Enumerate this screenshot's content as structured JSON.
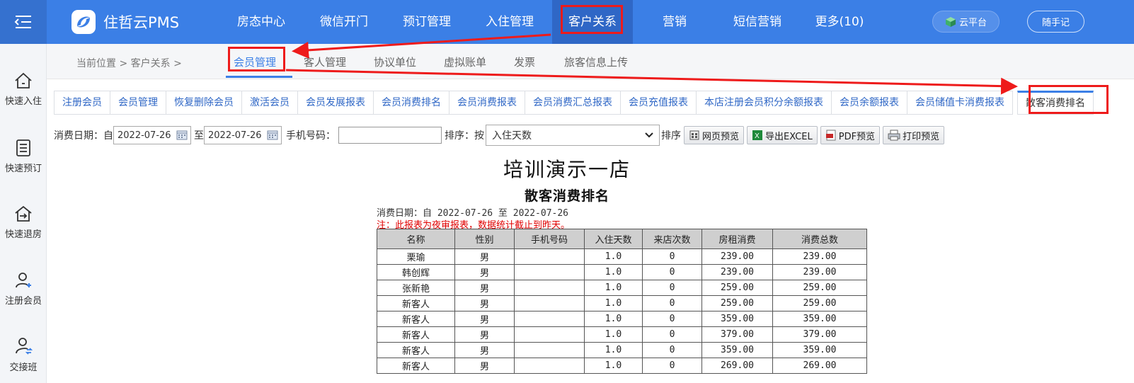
{
  "app": {
    "logo_text": "住哲云PMS"
  },
  "topnav": [
    "房态中心",
    "微信开门",
    "预订管理",
    "入住管理",
    "客户关系",
    "营销",
    "短信营销",
    "更多(10)"
  ],
  "topbar_buttons": {
    "cloud": "云平台",
    "notes": "随手记"
  },
  "sidebar": [
    "快速入住",
    "快速预订",
    "快速退房",
    "注册会员",
    "交接班"
  ],
  "breadcrumb": "当前位置 > 客户关系 >",
  "subtabs": [
    "会员管理",
    "客人管理",
    "协议单位",
    "虚拟账单",
    "发票",
    "旅客信息上传"
  ],
  "tabs": [
    "注册会员",
    "会员管理",
    "恢复删除会员",
    "激活会员",
    "会员发展报表",
    "会员消费排名",
    "会员消费报表",
    "会员消费汇总报表",
    "会员充值报表",
    "本店注册会员积分余额报表",
    "会员余额报表",
    "会员储值卡消费报表",
    "散客消费排名"
  ],
  "filter": {
    "date_label": "消费日期：自",
    "date_from": "2022-07-26",
    "to_label": "至",
    "date_to": "2022-07-26",
    "phone_label": "手机号码：",
    "phone_value": "",
    "sort_label": "排序：按",
    "sort_value": "入住天数",
    "sort_suffix": "排序",
    "buttons": [
      "网页预览",
      "导出EXCEL",
      "PDF预览",
      "打印预览"
    ]
  },
  "report": {
    "hotel": "培训演示一店",
    "title": "散客消费排名",
    "date_range": "消费日期：自 2022-07-26 至 2022-07-26",
    "note": "注：此报表为夜审报表，数据统计截止到昨天。",
    "columns": [
      "名称",
      "性别",
      "手机号码",
      "入住天数",
      "来店次数",
      "房租消费",
      "消费总数"
    ],
    "rows": [
      [
        "栗瑜",
        "男",
        "",
        "1.0",
        "0",
        "239.00",
        "239.00"
      ],
      [
        "韩创辉",
        "男",
        "",
        "1.0",
        "0",
        "239.00",
        "239.00"
      ],
      [
        "张新艳",
        "男",
        "",
        "1.0",
        "0",
        "259.00",
        "259.00"
      ],
      [
        "新客人",
        "男",
        "",
        "1.0",
        "0",
        "259.00",
        "259.00"
      ],
      [
        "新客人",
        "男",
        "",
        "1.0",
        "0",
        "359.00",
        "359.00"
      ],
      [
        "新客人",
        "男",
        "",
        "1.0",
        "0",
        "379.00",
        "379.00"
      ],
      [
        "新客人",
        "男",
        "",
        "1.0",
        "0",
        "359.00",
        "359.00"
      ],
      [
        "新客人",
        "男",
        "",
        "1.0",
        "0",
        "269.00",
        "269.00"
      ]
    ]
  },
  "colors": {
    "primary": "#3b7fe6",
    "annotation": "#ee1b1b",
    "note": "#e00000"
  }
}
